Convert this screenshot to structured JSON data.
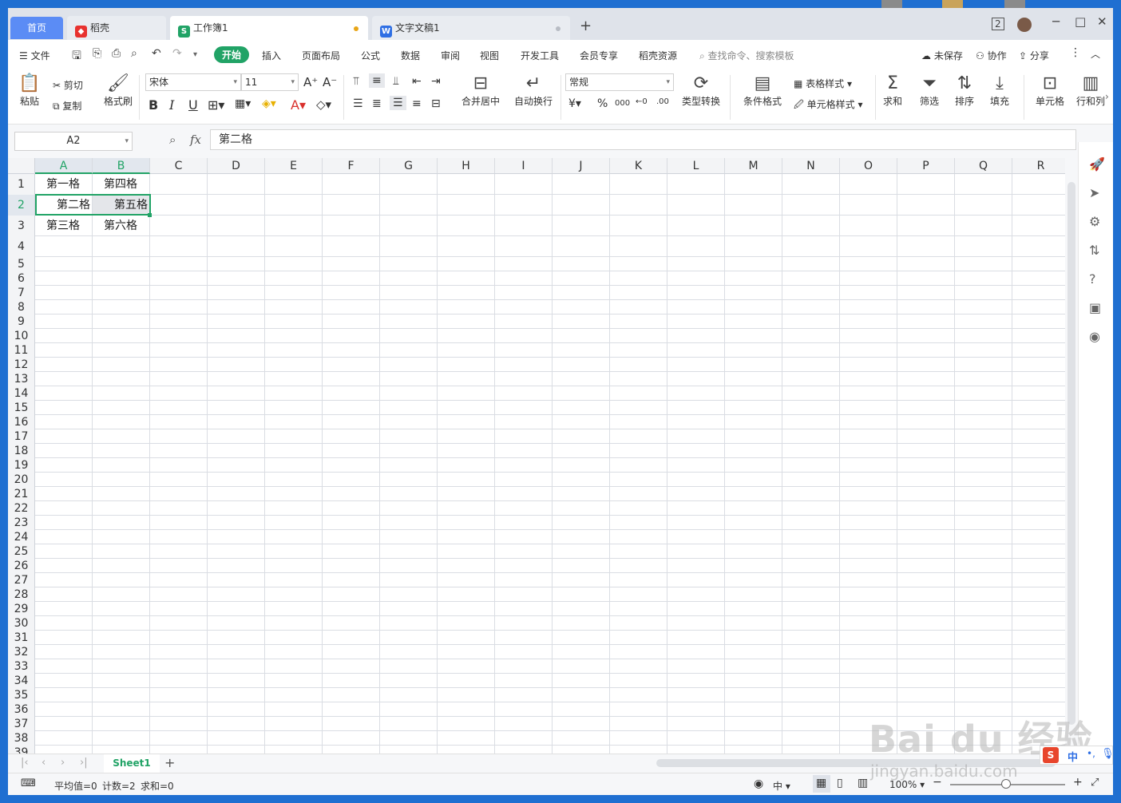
{
  "tabs": {
    "home": "首页",
    "daoke": "稻壳",
    "workbook": "工作簿1",
    "document": "文字文稿1",
    "new_tab": "+"
  },
  "menu": {
    "file": "文件",
    "items": [
      "开始",
      "插入",
      "页面布局",
      "公式",
      "数据",
      "审阅",
      "视图",
      "开发工具",
      "会员专享",
      "稻壳资源"
    ],
    "search_placeholder": "查找命令、搜索模板",
    "unsaved": "未保存",
    "collab": "协作",
    "share": "分享"
  },
  "ribbon": {
    "paste": "粘贴",
    "cut": "剪切",
    "copy": "复制",
    "format_painter": "格式刷",
    "font_name": "宋体",
    "font_size": "11",
    "merge_center": "合并居中",
    "wrap_text": "自动换行",
    "number_format": "常规",
    "type_convert": "类型转换",
    "cond_format": "条件格式",
    "table_style": "表格样式",
    "cell_style": "单元格样式",
    "sum": "求和",
    "filter": "筛选",
    "sort": "排序",
    "fill": "填充",
    "cells": "单元格",
    "row_col": "行和列",
    "currency": "¥",
    "percent": "%"
  },
  "formula_bar": {
    "cell_ref": "A2",
    "fx": "fx",
    "value": "第二格"
  },
  "columns": [
    "A",
    "B",
    "C",
    "D",
    "E",
    "F",
    "G",
    "H",
    "I",
    "J",
    "K",
    "L",
    "M",
    "N",
    "O",
    "P",
    "Q",
    "R"
  ],
  "cells": {
    "A1": "第一格",
    "B1": "第四格",
    "A2": "第二格",
    "B2": "第五格",
    "A3": "第三格",
    "B3": "第六格"
  },
  "sheet": {
    "active": "Sheet1",
    "add": "+"
  },
  "status": {
    "average": "平均值=0",
    "count": "计数=2",
    "sum": "求和=0",
    "zoom": "100%",
    "input_mode": "中"
  },
  "watermark": {
    "brand": "Bai du 经验",
    "url": "jingyan.baidu.com"
  },
  "colors": {
    "accent": "#21a366",
    "home_tab": "#5b8cf5",
    "selection": "#21a366"
  }
}
